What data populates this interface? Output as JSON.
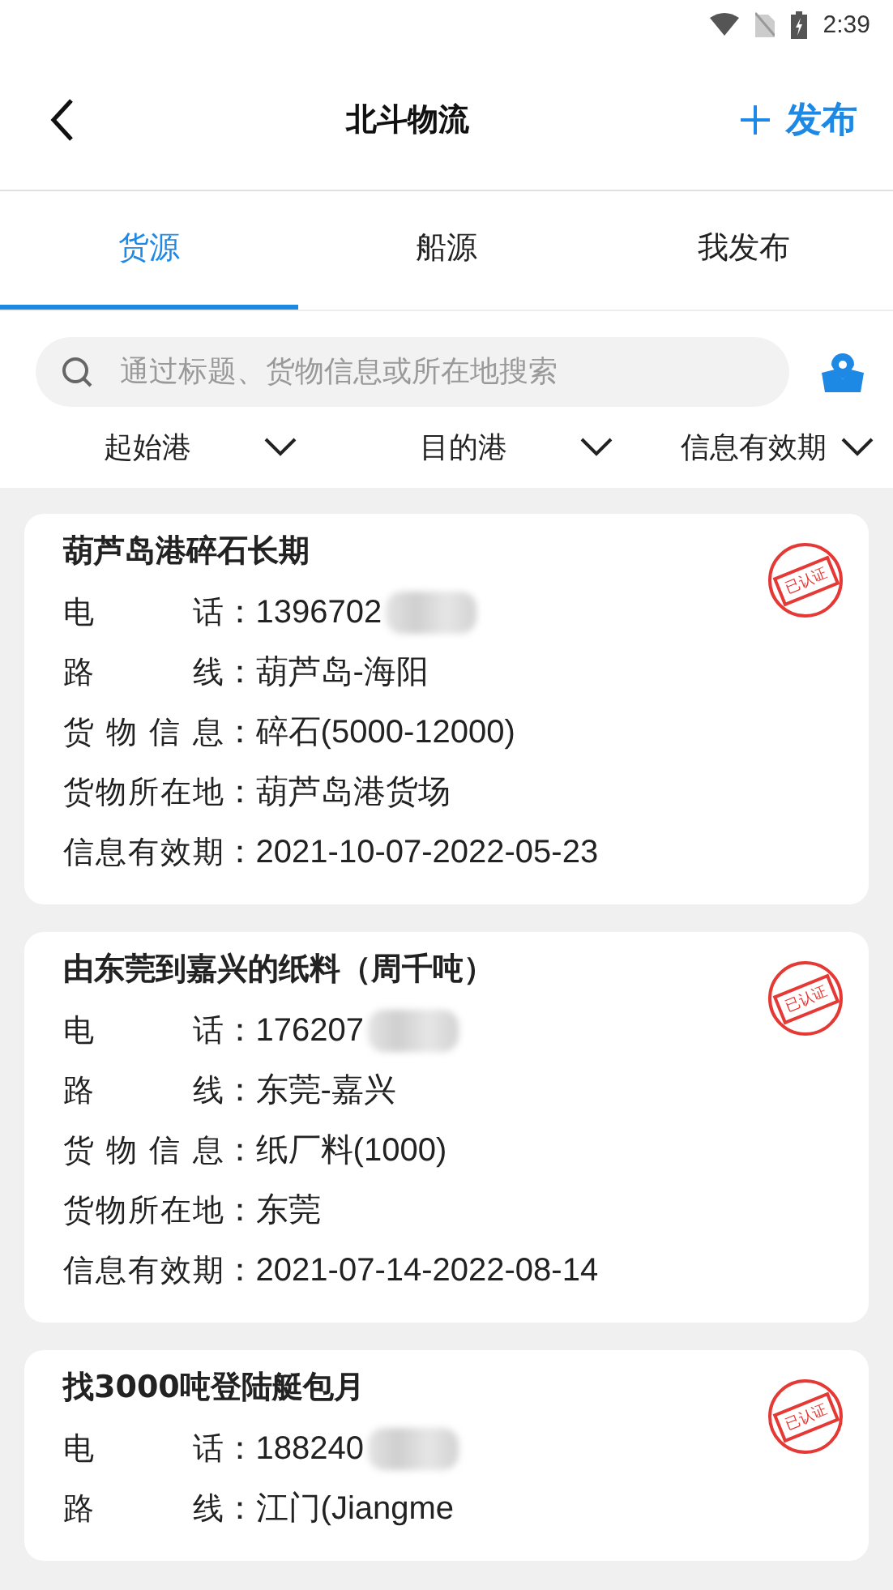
{
  "status_bar": {
    "time": "2:39"
  },
  "header": {
    "title": "北斗物流",
    "action": "发布"
  },
  "tabs": [
    {
      "label": "货源",
      "selected": true
    },
    {
      "label": "船源",
      "selected": false
    },
    {
      "label": "我发布",
      "selected": false
    }
  ],
  "search": {
    "placeholder": "通过标题、货物信息或所在地搜索"
  },
  "filters": [
    {
      "label": "起始港"
    },
    {
      "label": "目的港"
    },
    {
      "label": "信息有效期"
    }
  ],
  "cards": [
    {
      "title": "葫芦岛港碎石长期",
      "stamp": "已认证",
      "fields": [
        {
          "label": "电话",
          "value": "：1396702",
          "masked": true
        },
        {
          "label": "路线",
          "value": "：葫芦岛-海阳",
          "masked": false
        },
        {
          "label": "货物信息",
          "value": "：碎石(5000-12000)",
          "masked": false
        },
        {
          "label": "货物所在地",
          "value": "：葫芦岛港货场",
          "masked": false
        },
        {
          "label": "信息有效期",
          "value": "：2021-10-07-2022-05-23",
          "masked": false
        }
      ]
    },
    {
      "title": "由东莞到嘉兴的纸料（周千吨）",
      "stamp": "已认证",
      "fields": [
        {
          "label": "电话",
          "value": "：176207",
          "masked": true
        },
        {
          "label": "路线",
          "value": "：东莞-嘉兴",
          "masked": false
        },
        {
          "label": "货物信息",
          "value": "：纸厂料(1000)",
          "masked": false
        },
        {
          "label": "货物所在地",
          "value": "：东莞",
          "masked": false
        },
        {
          "label": "信息有效期",
          "value": "：2021-07-14-2022-08-14",
          "masked": false
        }
      ]
    },
    {
      "title": "找3000吨登陆艇包月",
      "stamp": "已认证",
      "fields": [
        {
          "label": "电话",
          "value": "：188240",
          "masked": true
        },
        {
          "label": "路线",
          "value": "：江门(Jiangme",
          "masked": false
        }
      ]
    }
  ]
}
